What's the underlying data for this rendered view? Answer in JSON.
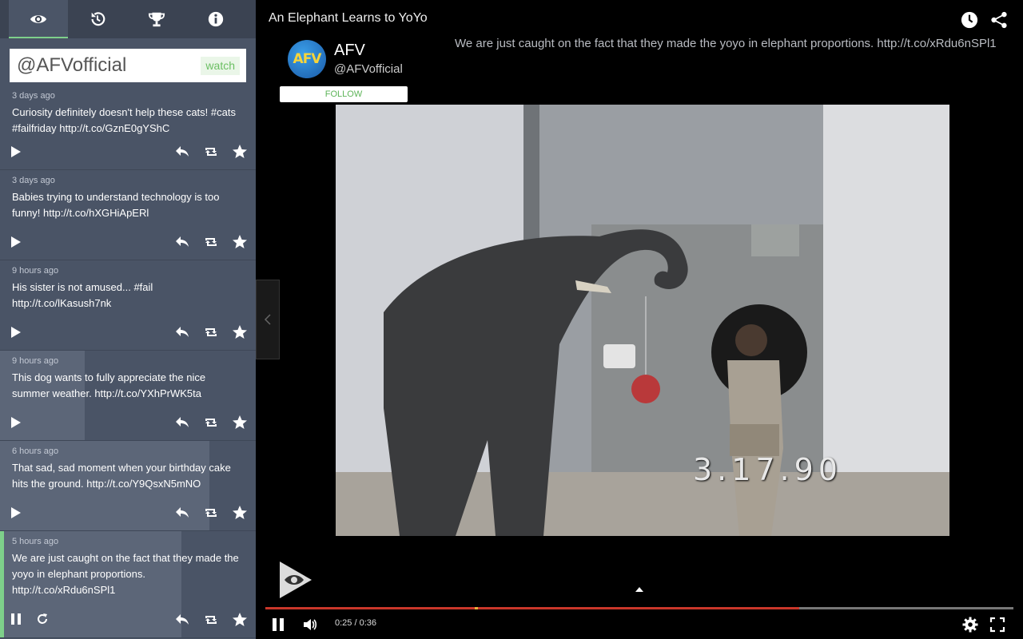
{
  "tabs": [
    {
      "icon": "eye-icon",
      "active": true
    },
    {
      "icon": "history-icon",
      "active": false
    },
    {
      "icon": "trophy-icon",
      "active": false
    },
    {
      "icon": "info-icon",
      "active": false
    }
  ],
  "search": {
    "value": "@AFVofficial",
    "watch_label": "watch"
  },
  "feed": [
    {
      "time": "3 days ago",
      "text": "Curiosity definitely doesn't help these cats! #cats #failfriday http://t.co/GznE0gYShC",
      "progress": 0
    },
    {
      "time": "3 days ago",
      "text": "Babies trying to understand technology is too funny! http://t.co/hXGHiApERl",
      "progress": 0
    },
    {
      "time": "9 hours ago",
      "text": "His sister is not amused... #fail http://t.co/lKasush7nk",
      "progress": 0
    },
    {
      "time": "9 hours ago",
      "text": "This dog wants to fully appreciate the nice summer weather. http://t.co/YXhPrWK5ta",
      "progress": 0.33
    },
    {
      "time": "6 hours ago",
      "text": "That sad, sad moment when your birthday cake hits the ground. http://t.co/Y9QsxN5mNO",
      "progress": 0.82
    },
    {
      "time": "5 hours ago",
      "text": "We are just caught on the fact that they made the yoyo in elephant proportions. http://t.co/xRdu6nSPl1",
      "progress": 0.71,
      "playing": true
    }
  ],
  "main": {
    "title": "An Elephant Learns to YoYo",
    "tweet_text": "We are just caught on the fact that they made the yoyo in elephant proportions. http://t.co/xRdu6nSPl1",
    "profile": {
      "name": "AFV",
      "handle": "@AFVofficial",
      "avatar_text": "AFV",
      "follow_label": "FOLLOW"
    },
    "video": {
      "date_stamp": "3.17.90"
    },
    "player": {
      "time": "0:25 / 0:36",
      "played": 0.714,
      "loaded": 1.0,
      "marker": 0.28
    }
  },
  "colors": {
    "accent_green": "#7ed08a",
    "sidebar_bg": "#4a5466",
    "progress_red": "#c9362a"
  }
}
